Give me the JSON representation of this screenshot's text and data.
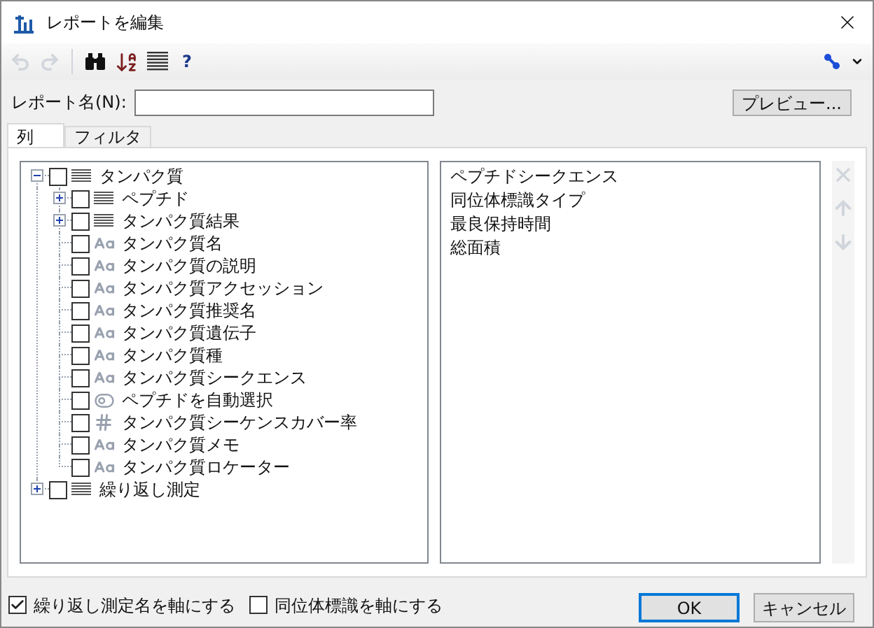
{
  "window": {
    "title": "レポートを編集"
  },
  "toolbar": {
    "undo_disabled": true,
    "redo_disabled": true,
    "help_label": "?"
  },
  "report_name": {
    "label": "レポート名(N):"
  },
  "preview_button": "プレビュー...",
  "tabs": [
    {
      "label": "列",
      "selected": true
    },
    {
      "label": "フィルタ",
      "selected": false
    }
  ],
  "tree": [
    {
      "label": "タンパク質",
      "kind": "group",
      "checked": false,
      "expanded": true,
      "children": [
        {
          "label": "ペプチド",
          "kind": "group",
          "checked": false,
          "expanded": false
        },
        {
          "label": "タンパク質結果",
          "kind": "group",
          "checked": false,
          "expanded": false
        },
        {
          "label": "タンパク質名",
          "kind": "text",
          "checked": false
        },
        {
          "label": "タンパク質の説明",
          "kind": "text",
          "checked": false
        },
        {
          "label": "タンパク質アクセッション",
          "kind": "text",
          "checked": false
        },
        {
          "label": "タンパク質推奨名",
          "kind": "text",
          "checked": false
        },
        {
          "label": "タンパク質遺伝子",
          "kind": "text",
          "checked": false
        },
        {
          "label": "タンパク質種",
          "kind": "text",
          "checked": false
        },
        {
          "label": "タンパク質シークエンス",
          "kind": "text",
          "checked": false
        },
        {
          "label": "ペプチドを自動選択",
          "kind": "bool",
          "checked": false
        },
        {
          "label": "タンパク質シーケンスカバー率",
          "kind": "number",
          "checked": false
        },
        {
          "label": "タンパク質メモ",
          "kind": "text",
          "checked": false
        },
        {
          "label": "タンパク質ロケーター",
          "kind": "text",
          "checked": false
        }
      ]
    },
    {
      "label": "繰り返し測定",
      "kind": "group",
      "checked": false,
      "expanded": false
    }
  ],
  "selected_columns": [
    "ペプチドシークエンス",
    "同位体標識タイプ",
    "最良保持時間",
    "総面積"
  ],
  "column_buttons": {
    "remove_disabled": true,
    "up_disabled": true,
    "down_disabled": true
  },
  "options": [
    {
      "label": "繰り返し測定名を軸にする",
      "checked": true
    },
    {
      "label": "同位体標識を軸にする",
      "checked": false
    }
  ],
  "buttons": [
    {
      "label": "OK",
      "default": true
    },
    {
      "label": "キャンセル",
      "default": false
    }
  ]
}
